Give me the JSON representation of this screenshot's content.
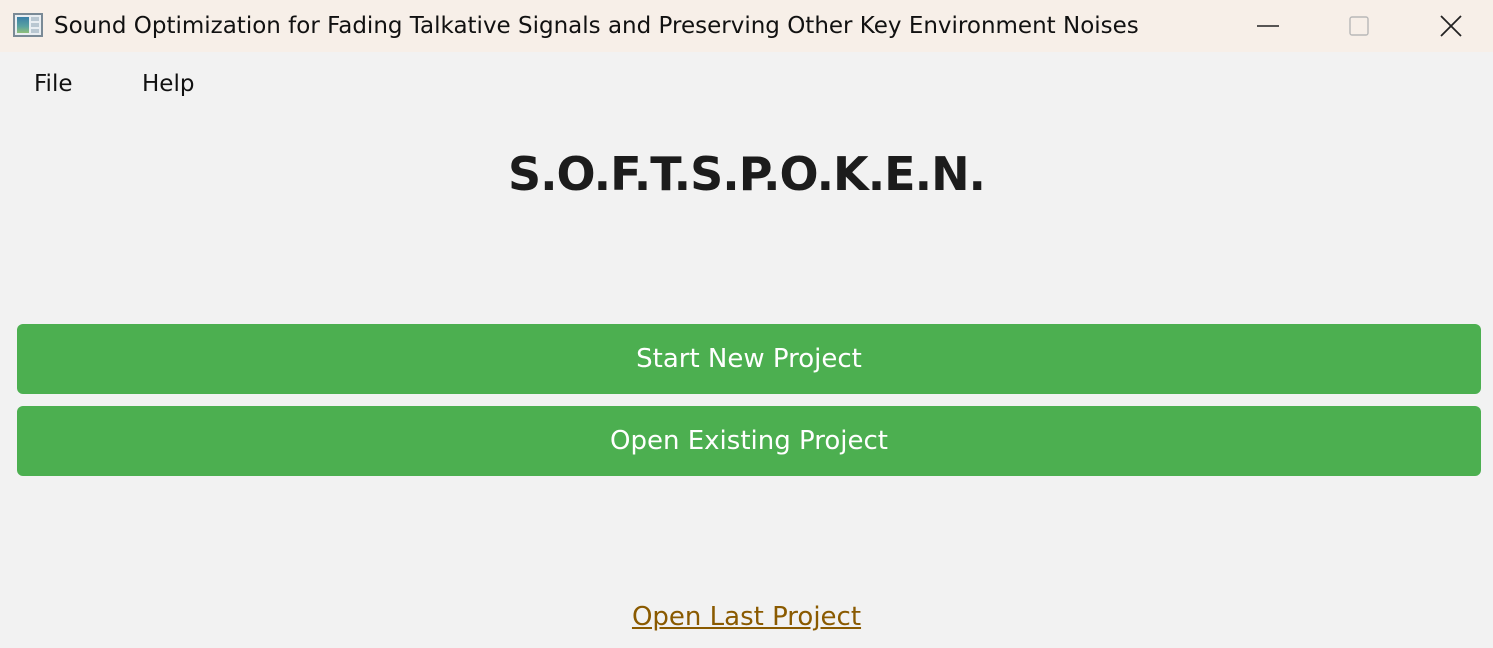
{
  "window": {
    "title": "Sound Optimization for Fading Talkative Signals and Preserving Other Key Environment Noises",
    "icon": "app-window-icon",
    "controls": {
      "minimize_icon": "minimize-icon",
      "maximize_icon": "maximize-icon",
      "close_icon": "close-icon"
    }
  },
  "menu": {
    "items": [
      {
        "label": "File"
      },
      {
        "label": "Help"
      }
    ]
  },
  "main": {
    "heading": "S.O.F.T.S.P.O.K.E.N.",
    "buttons": {
      "start_new": "Start New Project",
      "open_existing": "Open Existing Project"
    },
    "link": {
      "open_last": "Open Last Project"
    }
  },
  "colors": {
    "titlebar_bg": "#f7efe8",
    "window_bg": "#f2f2f2",
    "button_bg": "#4caf50",
    "button_text": "#ffffff",
    "link_color": "#8a5a00"
  }
}
